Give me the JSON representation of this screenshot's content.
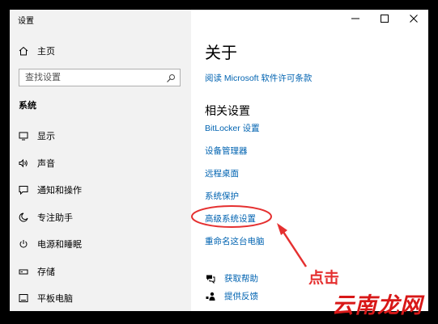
{
  "window": {
    "title": "设置"
  },
  "sidebar": {
    "home": {
      "label": "主页",
      "icon": "home-icon"
    },
    "search": {
      "placeholder": "查找设置",
      "icon": "search-icon"
    },
    "section_title": "系统",
    "items": [
      {
        "label": "显示",
        "icon": "display-icon"
      },
      {
        "label": "声音",
        "icon": "sound-icon"
      },
      {
        "label": "通知和操作",
        "icon": "notification-icon"
      },
      {
        "label": "专注助手",
        "icon": "moon-icon"
      },
      {
        "label": "电源和睡眠",
        "icon": "power-icon"
      },
      {
        "label": "存储",
        "icon": "storage-icon"
      },
      {
        "label": "平板电脑",
        "icon": "tablet-icon"
      }
    ]
  },
  "content": {
    "page_title": "关于",
    "license_link": "阅读 Microsoft 软件许可条款",
    "related_title": "相关设置",
    "related_links": [
      "BitLocker 设置",
      "设备管理器",
      "远程桌面",
      "系统保护",
      "高级系统设置",
      "重命名这台电脑"
    ],
    "help": [
      {
        "label": "获取帮助",
        "icon": "help-chat-icon"
      },
      {
        "label": "提供反馈",
        "icon": "feedback-icon"
      }
    ]
  },
  "annotation": {
    "click_hint": "点击",
    "highlight_color": "#e53030"
  },
  "watermark": "云南龙网",
  "colors": {
    "link": "#0063b1",
    "sidebar_bg": "#f2f2f2",
    "frame": "#000000"
  }
}
